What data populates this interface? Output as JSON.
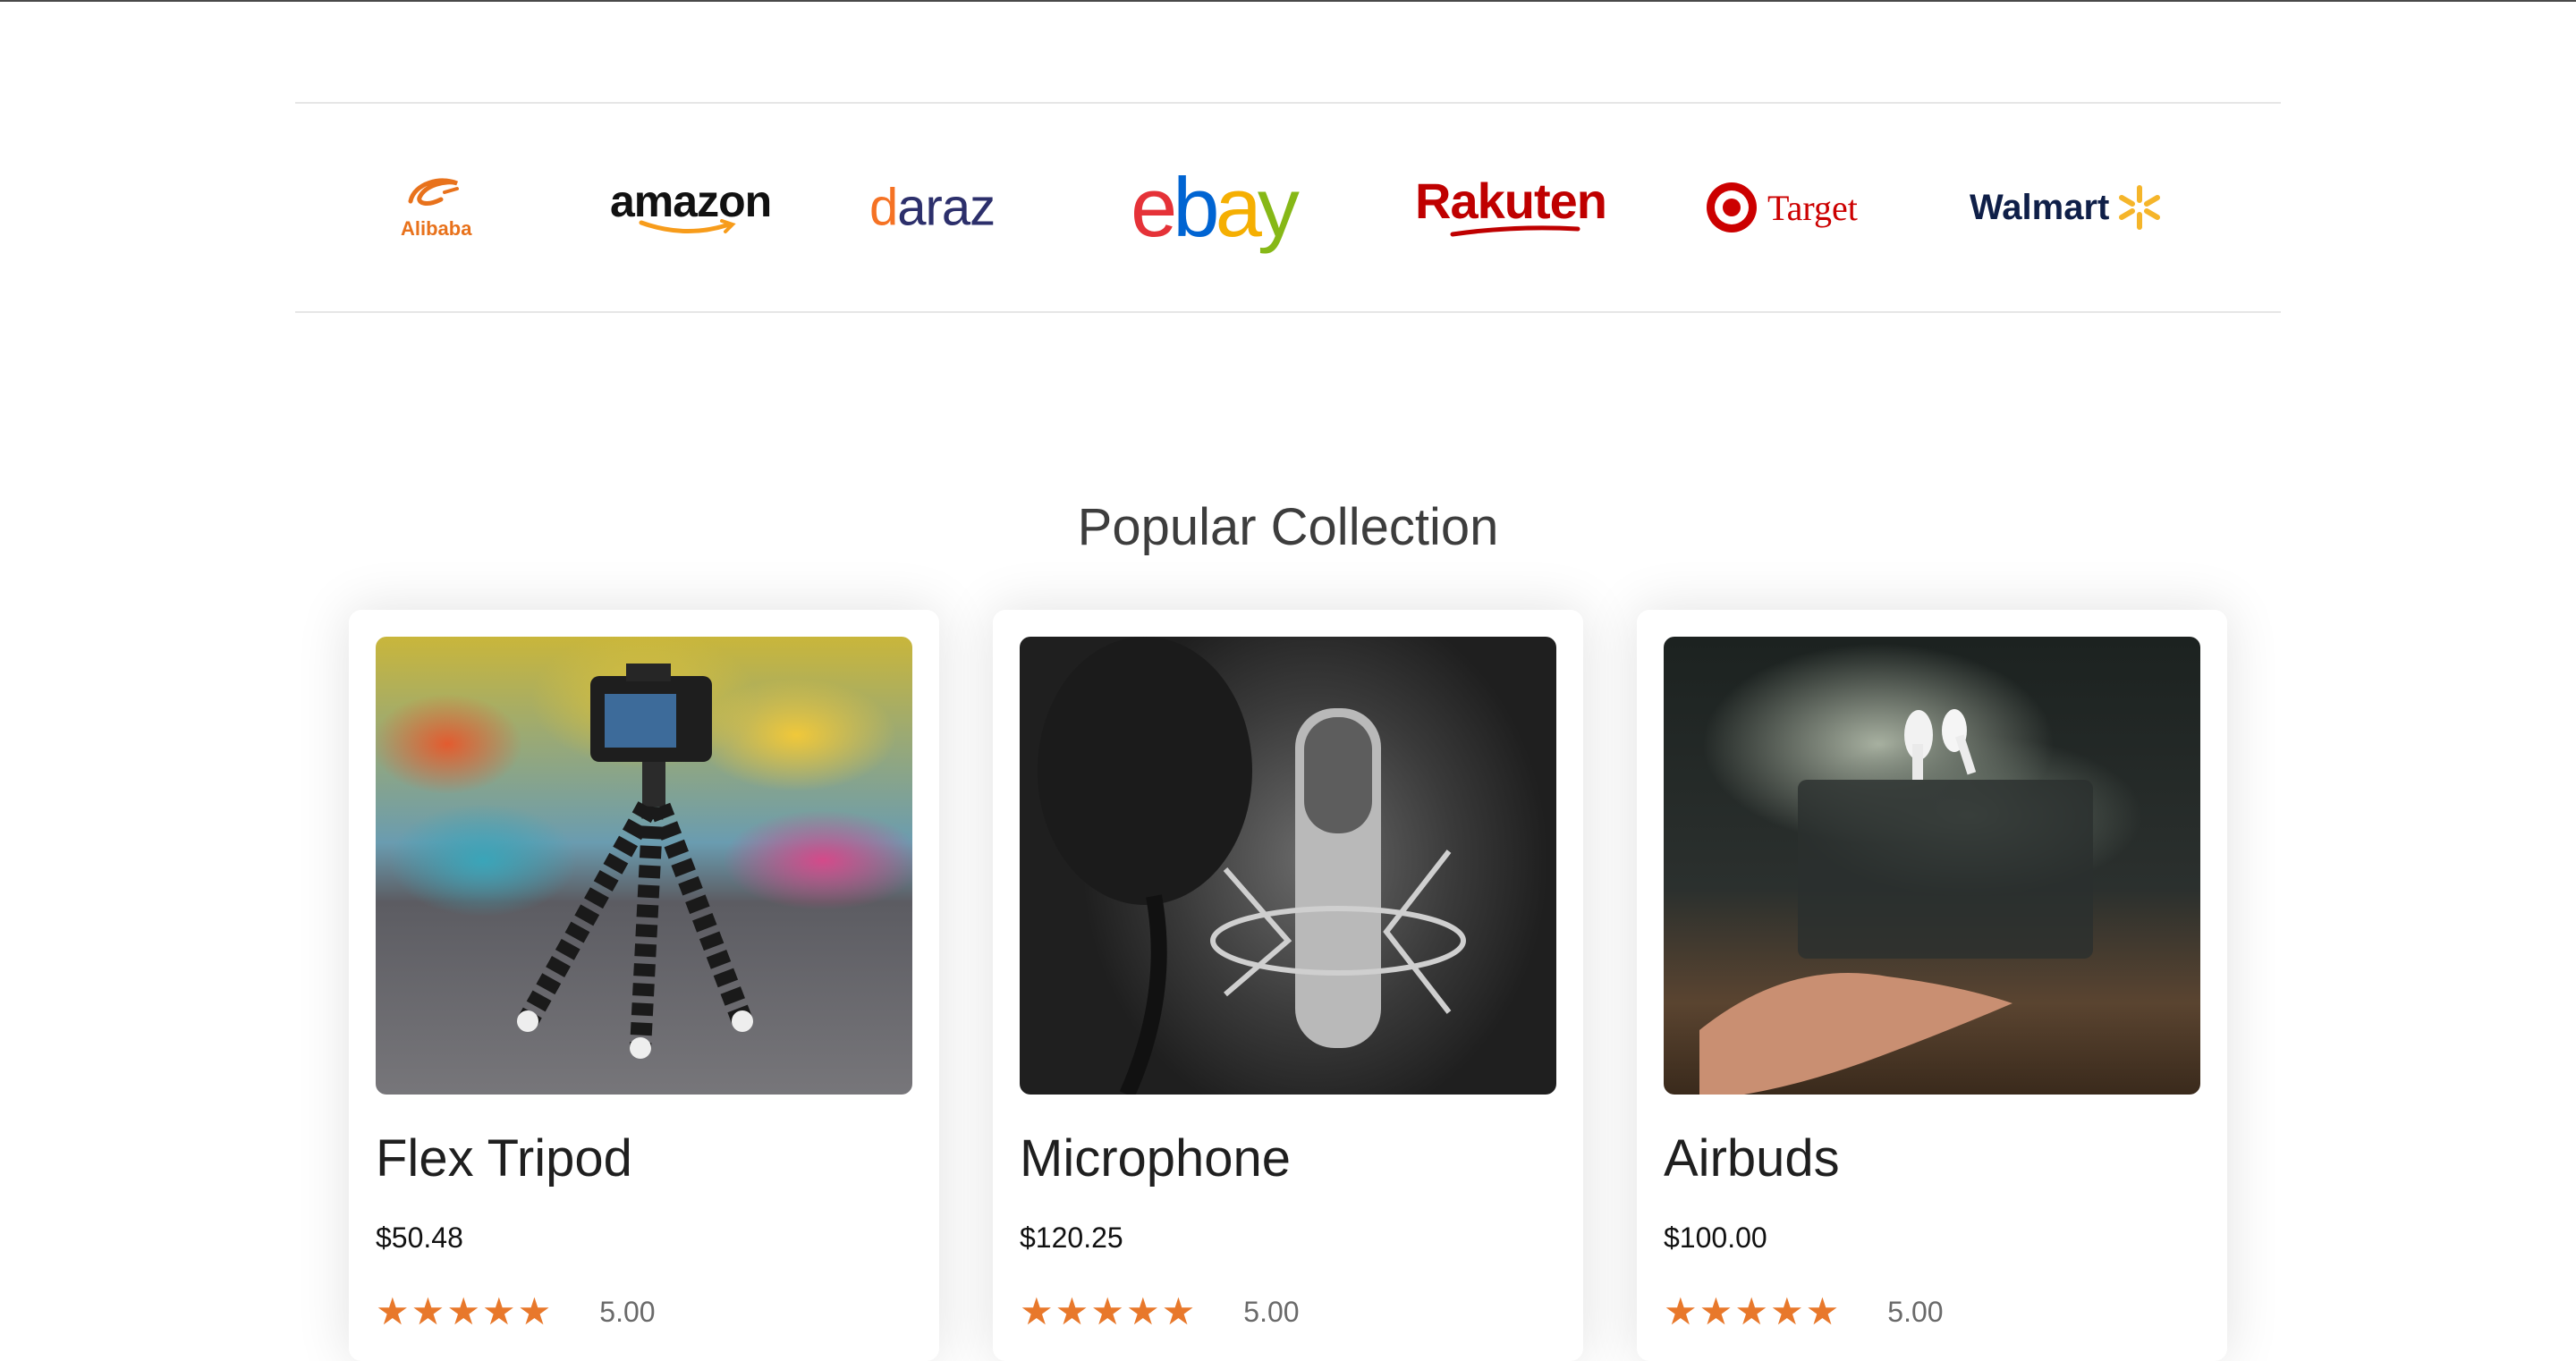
{
  "brands": {
    "alibaba": {
      "mark": "ℭ",
      "label": "Alibaba"
    },
    "amazon": {
      "label": "amazon"
    },
    "daraz": {
      "first": "d",
      "rest": "araz"
    },
    "ebay": {
      "e": "e",
      "b": "b",
      "a": "a",
      "y": "y"
    },
    "rakuten": {
      "label": "Rakuten"
    },
    "target": {
      "label": "Target"
    },
    "walmart": {
      "label": "Walmart"
    }
  },
  "section": {
    "title": "Popular Collection"
  },
  "products": [
    {
      "name": "Flex Tripod",
      "price": "$50.48",
      "rating": "5.00",
      "stars": 5,
      "image": "tripod-photo"
    },
    {
      "name": "Microphone",
      "price": "$120.25",
      "rating": "5.00",
      "stars": 5,
      "image": "microphone-photo"
    },
    {
      "name": "Airbuds",
      "price": "$100.00",
      "rating": "5.00",
      "stars": 5,
      "image": "airbuds-photo"
    }
  ],
  "colors": {
    "star": "#e8782b",
    "alibaba": "#e8721c",
    "rakuten": "#bf0000",
    "target": "#cc0000",
    "walmart": "#0f1f48",
    "walmart_spark": "#f5b52a"
  }
}
